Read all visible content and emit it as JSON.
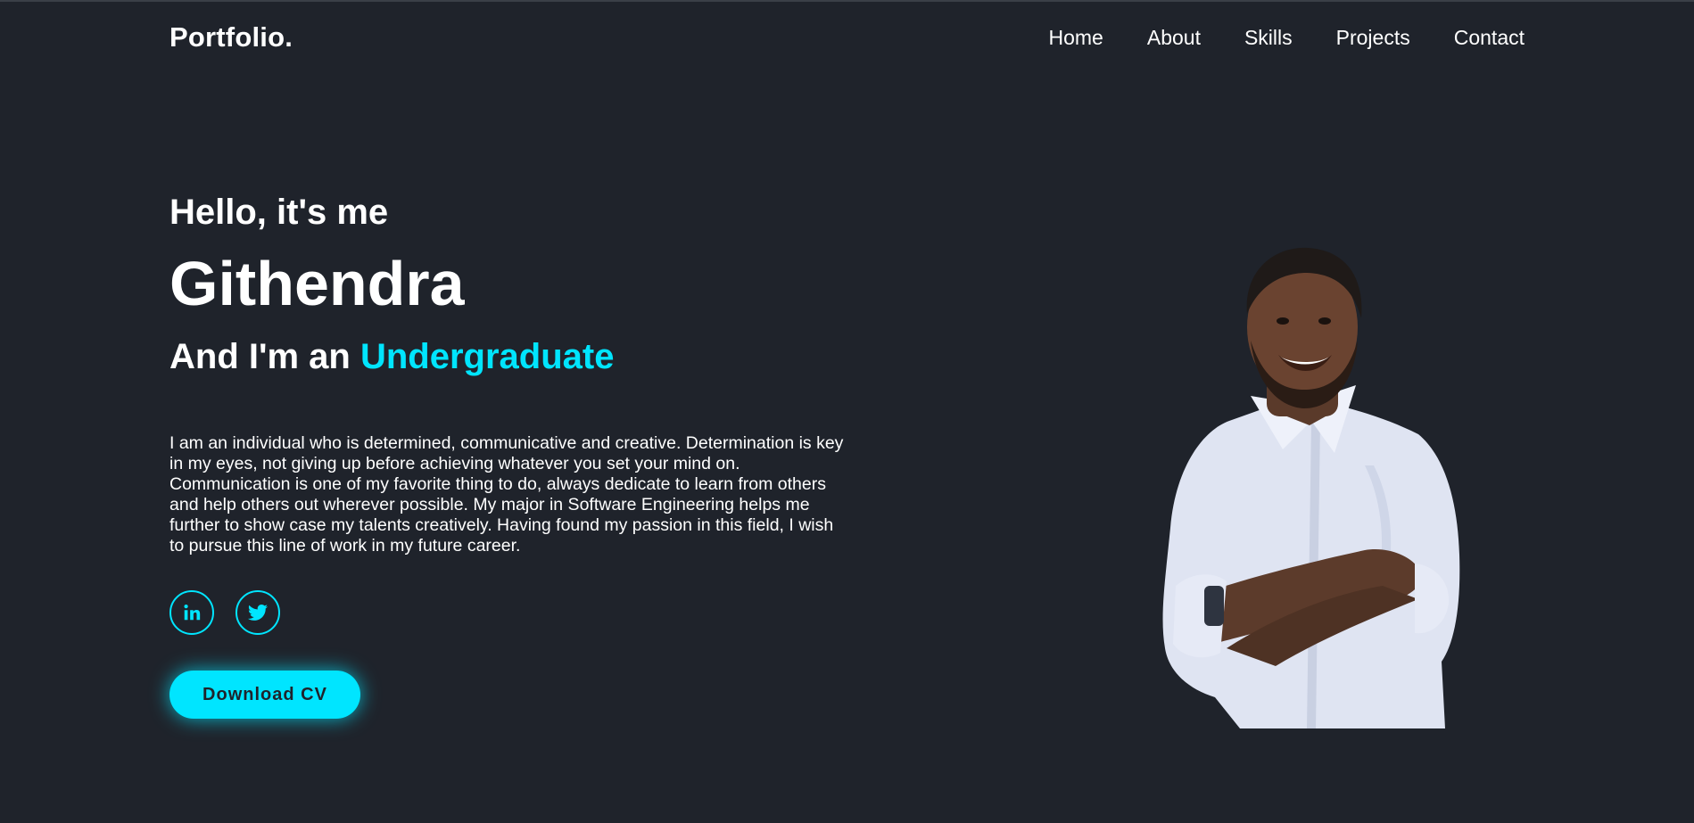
{
  "header": {
    "logo": "Portfolio.",
    "nav": [
      "Home",
      "About",
      "Skills",
      "Projects",
      "Contact"
    ]
  },
  "hero": {
    "greeting": "Hello, it's me",
    "name": "Githendra",
    "role_prefix": "And I'm an ",
    "role_highlight": "Undergraduate",
    "bio": "I am an individual who is determined, communicative and creative. Determination is key in my eyes, not giving up before achieving whatever you set your mind on. Communication is one of my favorite thing to do, always dedicate to learn from others and help others out wherever possible. My major in Software Engineering helps me further to show case my talents creatively. Having found my passion in this field, I wish to pursue this line of work in my future career.",
    "socials": [
      {
        "icon": "linkedin-icon",
        "label": "in"
      },
      {
        "icon": "twitter-icon",
        "label": ""
      }
    ],
    "cv_button": "Download CV"
  },
  "colors": {
    "background": "#1f232b",
    "accent": "#00e5ff",
    "text": "#ffffff"
  }
}
